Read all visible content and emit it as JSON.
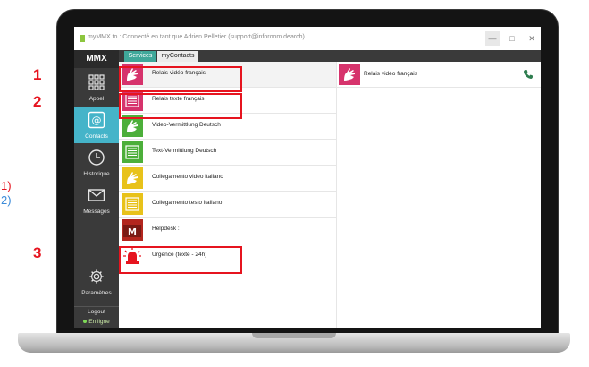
{
  "window": {
    "title": "myMMX to : Connecté en tant que Adrien Pelletier (support@inforoom.dearch)"
  },
  "sidebar": {
    "brand": "MMX",
    "items": [
      {
        "label": "Appel",
        "icon": "dialpad-icon"
      },
      {
        "label": "Contacts",
        "icon": "at-sign-icon"
      },
      {
        "label": "Historique",
        "icon": "clock-icon"
      },
      {
        "label": "Messages",
        "icon": "envelope-icon"
      }
    ],
    "settings_label": "Paramètres",
    "logout_label": "Logout",
    "status_label": "En ligne"
  },
  "tabs": [
    {
      "label": "Services"
    },
    {
      "label": "myContacts"
    }
  ],
  "services": [
    {
      "label": "Relais vidéo français",
      "color": "#d6336c"
    },
    {
      "label": "Relais texte français",
      "color": "#d6336c"
    },
    {
      "label": "Video-Vermittlung Deutsch",
      "color": "#4caf3a"
    },
    {
      "label": "Text-Vermittlung Deutsch",
      "color": "#4caf3a"
    },
    {
      "label": "Collegamento video italiano",
      "color": "#e8c21a"
    },
    {
      "label": "Collegamento testo italiano",
      "color": "#e8c21a"
    },
    {
      "label": "Helpdesk :",
      "color": "#b3261e"
    },
    {
      "label": "Urgence (texte - 24h)",
      "color": "#e6141f"
    }
  ],
  "detail": {
    "title": "Relais vidéo français",
    "call_icon": "phone-icon"
  },
  "annotations": {
    "n1": "1",
    "n2": "2",
    "n3": "3",
    "side1": "1)",
    "side2": "2)"
  },
  "colors": {
    "accent": "#45b4c9",
    "highlight": "#e6141f",
    "tab_active": "#3fa89a"
  }
}
